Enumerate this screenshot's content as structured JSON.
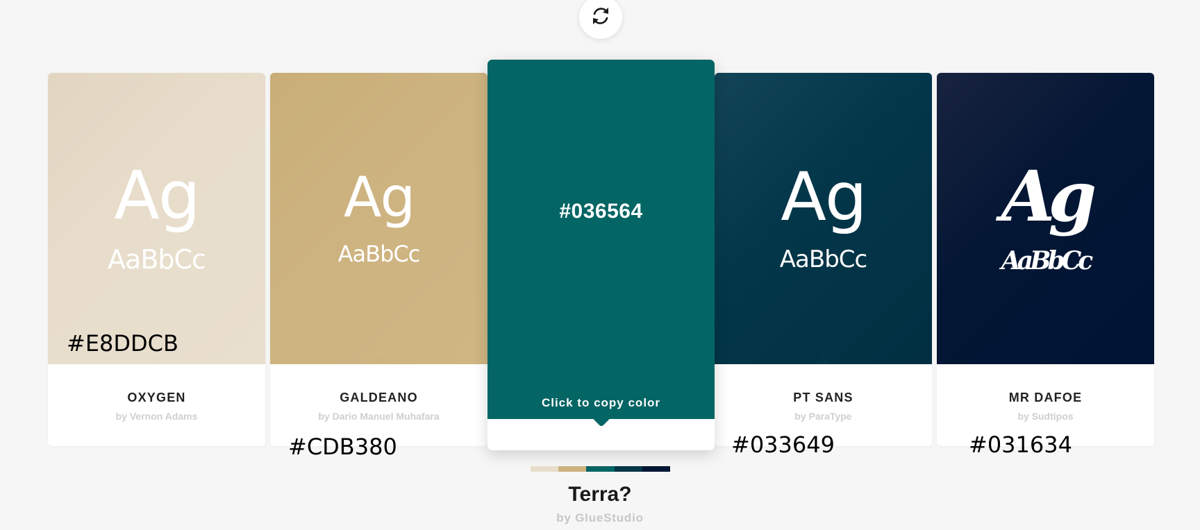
{
  "refresh_icon": "refresh-icon",
  "cards": [
    {
      "color": "#E8DDCB",
      "gradient_end": "#e3d7c3",
      "font_name": "OXYGEN",
      "author": "by Vernon Adams",
      "sample_large": "Ag",
      "sample_small": "AaBbCc",
      "hex_label": "#E8DDCB"
    },
    {
      "color": "#CDB380",
      "gradient_end": "#cbb27e",
      "font_name": "GALDEANO",
      "author": "by Dario Manuel Muhafara",
      "sample_large": "Ag",
      "sample_small": "AaBbCc",
      "hex_label": "#CDB380"
    },
    {
      "color": "#036564",
      "font_name": "",
      "author": "",
      "hex_display": "#036564",
      "copy_label": "Click to copy color"
    },
    {
      "color": "#033649",
      "gradient_end": "#0b3f54",
      "font_name": "PT SANS",
      "author": "by ParaType",
      "sample_large": "Ag",
      "sample_small": "AaBbCc",
      "hex_label": "#033649"
    },
    {
      "color": "#031634",
      "gradient_end": "#14213f",
      "font_name": "MR DAFOE",
      "author": "by Sudtipos",
      "sample_large": "Ag",
      "sample_small": "AaBbCc",
      "hex_label": "#031634"
    }
  ],
  "palette": {
    "name": "Terra?",
    "author": "by GlueStudio",
    "colors": [
      "#E8DDCB",
      "#CDB380",
      "#036564",
      "#033649",
      "#031634"
    ]
  }
}
